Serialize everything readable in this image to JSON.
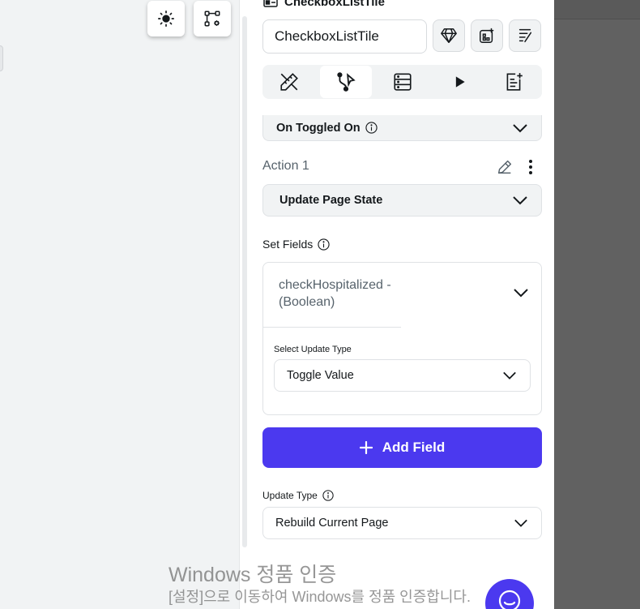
{
  "widget": {
    "title": "CheckboxListTile",
    "name_value": "CheckboxListTile"
  },
  "icons": {
    "widget": "checkbox-widget-icon",
    "gem": "gem-icon",
    "add_component": "add-component-icon",
    "convert": "convert-icon",
    "theme": "sun-icon",
    "graph_settings": "graph-settings-icon"
  },
  "tabs": [
    {
      "icon": "properties-icon",
      "active": false
    },
    {
      "icon": "actions-icon",
      "active": true
    },
    {
      "icon": "backend-query-icon",
      "active": false
    },
    {
      "icon": "animations-icon",
      "active": false
    },
    {
      "icon": "documentation-icon",
      "active": false
    }
  ],
  "trigger": {
    "label": "On Toggled On"
  },
  "action": {
    "title": "Action 1",
    "type": "Update Page State"
  },
  "set_fields": {
    "label": "Set Fields",
    "field": "checkHospitalized -\n(Boolean)",
    "update_type_label": "Select Update Type",
    "update_type_value": "Toggle Value"
  },
  "add_field_label": "Add Field",
  "update_type": {
    "label": "Update Type",
    "value": "Rebuild Current Page"
  },
  "watermark": {
    "line1": "Windows 정품 인증",
    "line2": "[설정]으로 이동하여 Windows를 정품 인증합니다."
  },
  "colors": {
    "primary": "#4b39ef",
    "panel_bg": "#ffffff",
    "muted": "#f1f3f4",
    "dark_overlay": "#616161"
  }
}
